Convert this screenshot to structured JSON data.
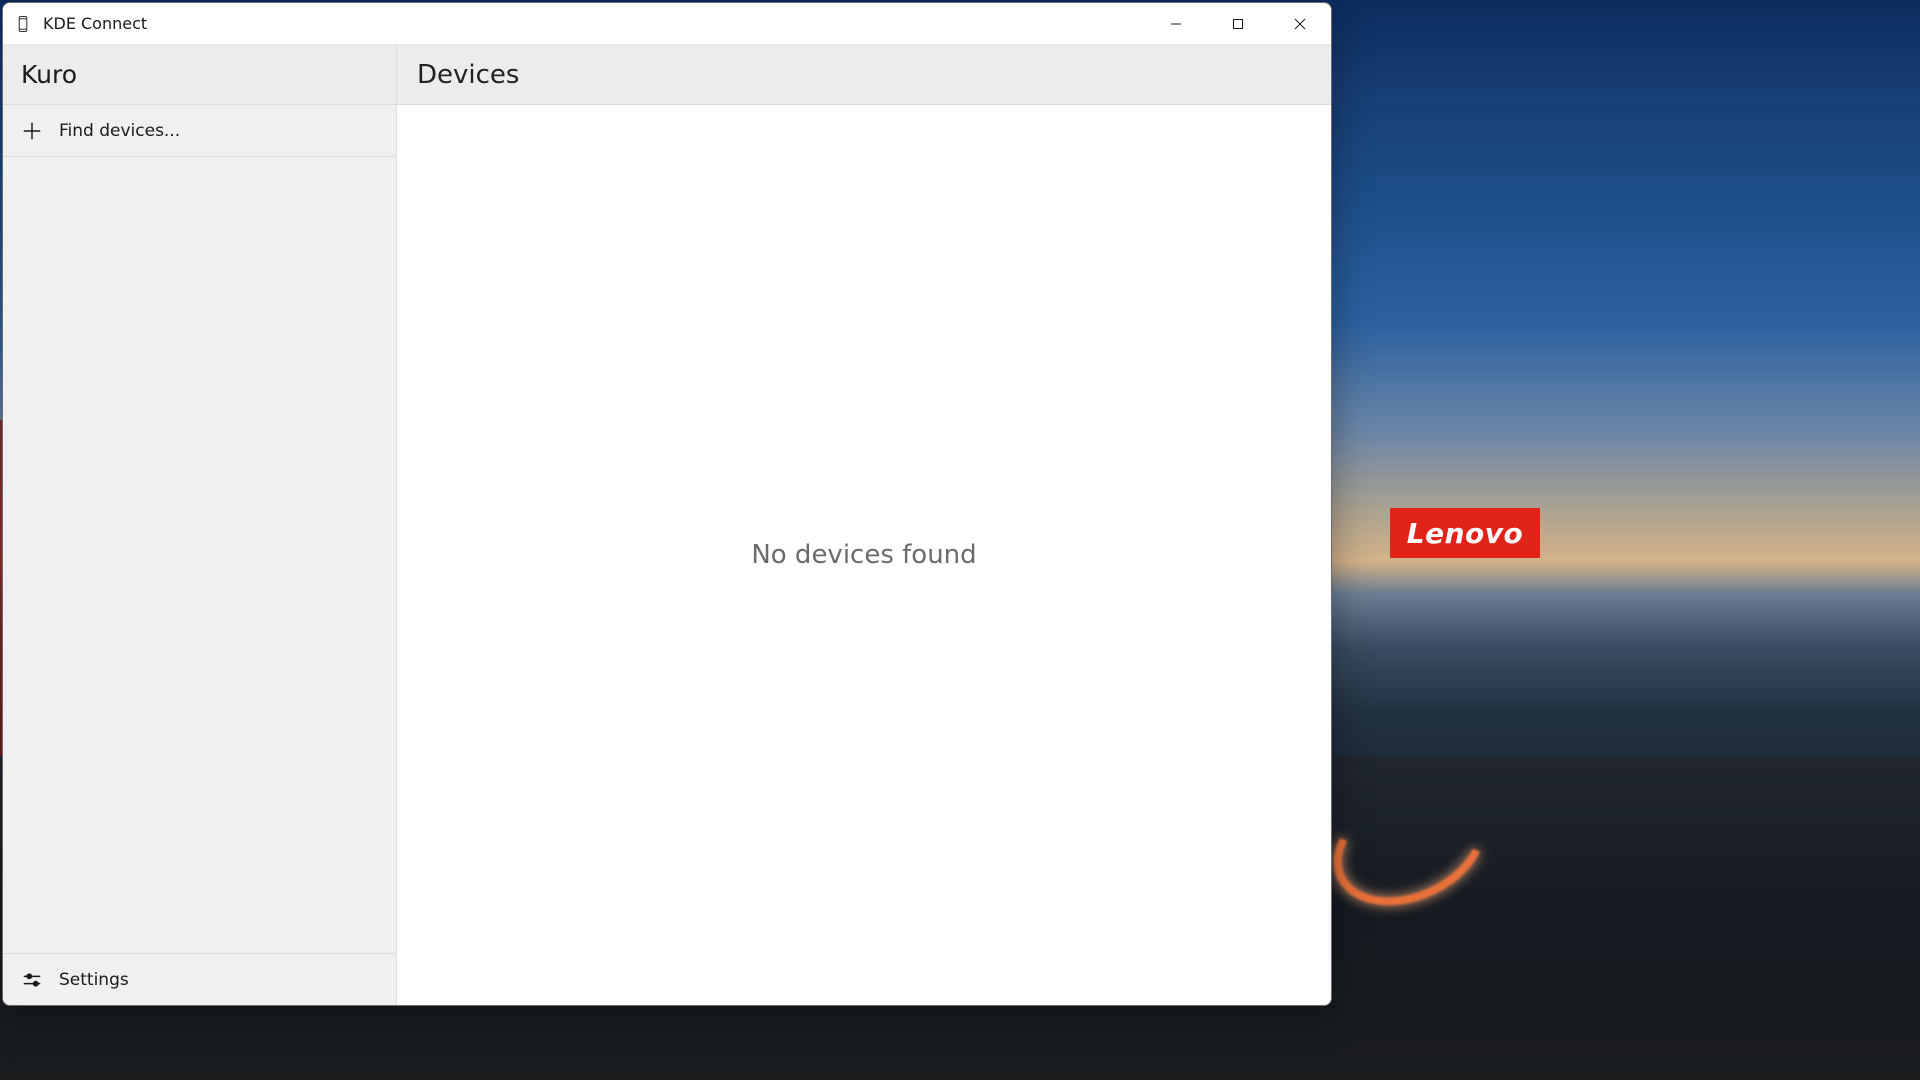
{
  "wallpaper": {
    "brand_label": "Lenovo"
  },
  "window": {
    "title": "KDE Connect",
    "controls": {
      "minimize_name": "minimize",
      "maximize_name": "maximize",
      "close_name": "close"
    }
  },
  "sidebar": {
    "device_name": "Kuro",
    "find_devices_label": "Find devices...",
    "settings_label": "Settings"
  },
  "main": {
    "header_title": "Devices",
    "empty_state_text": "No devices found"
  }
}
